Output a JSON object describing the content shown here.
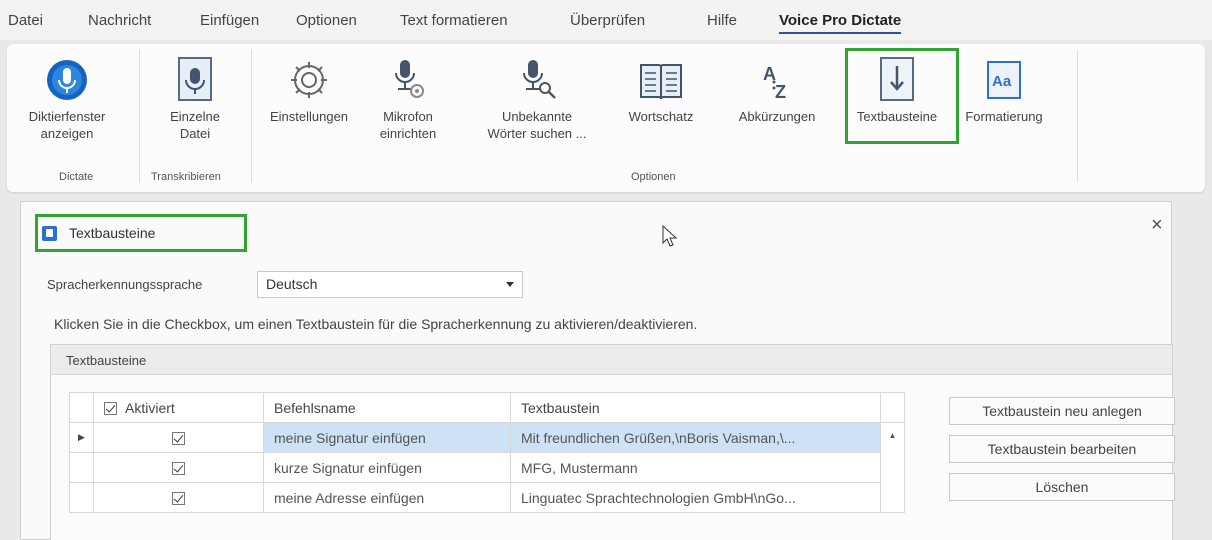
{
  "menu": [
    "Datei",
    "Nachricht",
    "Einfügen",
    "Optionen",
    "Text formatieren",
    "Überprüfen",
    "Hilfe",
    "Voice Pro Dictate"
  ],
  "ribbon": {
    "buttons": [
      {
        "label": "Diktierfenster\nanzeigen",
        "icon": "microphone-circle-icon"
      },
      {
        "label": "Einzelne\nDatei",
        "icon": "audio-file-icon"
      },
      {
        "label": "Einstellungen",
        "icon": "gear-icon"
      },
      {
        "label": "Mikrofon\neinrichten",
        "icon": "microphone-gear-icon"
      },
      {
        "label": "Unbekannte\nWörter suchen ...",
        "icon": "microphone-search-icon"
      },
      {
        "label": "Wortschatz",
        "icon": "book-icon"
      },
      {
        "label": "Abkürzungen",
        "icon": "a-z-icon"
      },
      {
        "label": "Textbausteine",
        "icon": "text-block-arrow-icon"
      },
      {
        "label": "Formatierung",
        "icon": "format-aa-icon"
      }
    ],
    "groups": [
      "Dictate",
      "Transkribieren",
      "Optionen"
    ]
  },
  "dialog": {
    "title": "Textbausteine",
    "close": "×",
    "language_label": "Spracherkennungssprache",
    "language_value": "Deutsch",
    "hint": "Klicken Sie in die Checkbox, um einen Textbaustein für die Spracherkennung zu aktivieren/deaktivieren.",
    "group_title": "Textbausteine",
    "table": {
      "headers": [
        "Aktiviert",
        "Befehlsname",
        "Textbaustein"
      ],
      "rows": [
        {
          "active": true,
          "name": "meine Signatur einfügen",
          "text": "Mit freundlichen Grüßen,\\nBoris Vaisman,\\...",
          "selected": true
        },
        {
          "active": true,
          "name": "kurze Signatur einfügen",
          "text": "MFG, Mustermann",
          "selected": false
        },
        {
          "active": true,
          "name": "meine Adresse einfügen",
          "text": "Linguatec Sprachtechnologien GmbH\\nGo...",
          "selected": false
        }
      ]
    },
    "buttons": [
      "Textbaustein neu anlegen",
      "Textbaustein bearbeiten",
      "Löschen"
    ]
  },
  "colors": {
    "accent": "#2b579a",
    "highlight_box": "#2fa62f",
    "selection": "#cde2f5"
  }
}
